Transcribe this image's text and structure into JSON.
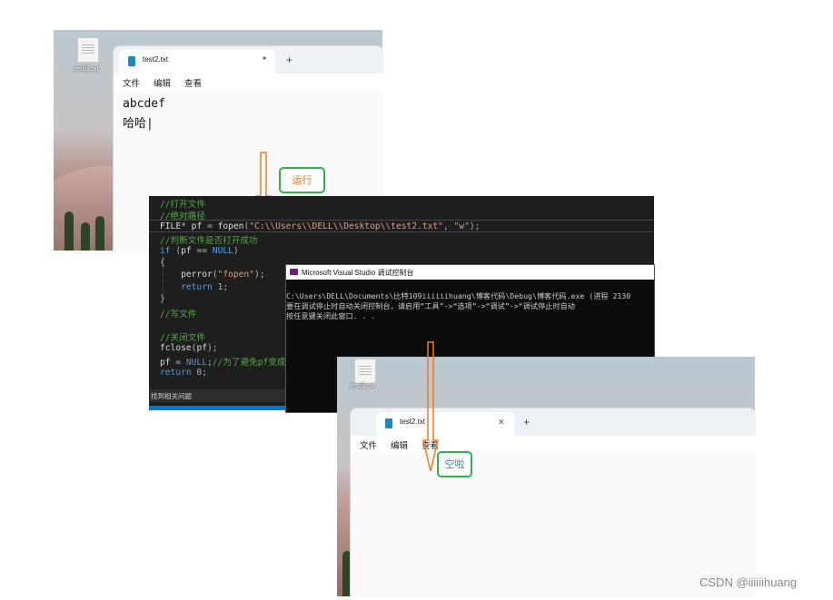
{
  "screen1": {
    "desktop_file_label": "test双.txt",
    "tab_title": "test2.txt",
    "tab_dot": "●",
    "tab_plus": "+",
    "menu": [
      "文件",
      "编辑",
      "查看"
    ],
    "content_lines": [
      "abcdef",
      "哈哈|"
    ]
  },
  "annotation_run": {
    "label": "运行",
    "color": "#e9741f"
  },
  "editor": {
    "lines": [
      [
        {
          "t": "//打开文件",
          "c": "com"
        }
      ],
      [
        {
          "t": "//绝对路径",
          "c": "com"
        }
      ],
      [
        {
          "t": "FILE",
          "c": "id"
        },
        {
          "t": "* ",
          "c": "pu"
        },
        {
          "t": "pf",
          "c": "id"
        },
        {
          "t": " = ",
          "c": "pu"
        },
        {
          "t": "fopen",
          "c": "id"
        },
        {
          "t": "(",
          "c": "pu"
        },
        {
          "t": "\"C:\\\\Users\\\\DELL\\\\Desktop\\\\test2.txt\"",
          "c": "str"
        },
        {
          "t": ", ",
          "c": "pu"
        },
        {
          "t": "\"w\"",
          "c": "str"
        },
        {
          "t": ");",
          "c": "pu"
        }
      ],
      [
        {
          "t": "//判断文件是否打开成功",
          "c": "com"
        }
      ],
      [
        {
          "t": "if",
          "c": "kw"
        },
        {
          "t": " (",
          "c": "pu"
        },
        {
          "t": "pf",
          "c": "id"
        },
        {
          "t": " == ",
          "c": "pu"
        },
        {
          "t": "NULL",
          "c": "kw"
        },
        {
          "t": ")",
          "c": "pu"
        }
      ],
      [
        {
          "t": "{",
          "c": "pu"
        }
      ],
      [
        {
          "t": "    ",
          "c": "pu"
        },
        {
          "t": "perror",
          "c": "id"
        },
        {
          "t": "(",
          "c": "pu"
        },
        {
          "t": "\"fopen\"",
          "c": "str"
        },
        {
          "t": ");",
          "c": "pu"
        }
      ],
      [
        {
          "t": "    ",
          "c": "pu"
        },
        {
          "t": "return",
          "c": "kw"
        },
        {
          "t": " 1;",
          "c": "pu"
        }
      ],
      [
        {
          "t": "}",
          "c": "pu"
        }
      ],
      [
        {
          "t": "//写文件",
          "c": "com"
        }
      ],
      [
        {
          "t": "",
          "c": "pu"
        }
      ],
      [
        {
          "t": "//关闭文件",
          "c": "com"
        }
      ],
      [
        {
          "t": "fclose",
          "c": "id"
        },
        {
          "t": "(",
          "c": "pu"
        },
        {
          "t": "pf",
          "c": "id"
        },
        {
          "t": ");",
          "c": "pu"
        }
      ],
      [
        {
          "t": "pf",
          "c": "id"
        },
        {
          "t": " = ",
          "c": "pu"
        },
        {
          "t": "NULL",
          "c": "kw"
        },
        {
          "t": ";",
          "c": "pu"
        },
        {
          "t": "//为了避免pf变成野",
          "c": "com"
        }
      ],
      [
        {
          "t": "return",
          "c": "kw"
        },
        {
          "t": " 0;",
          "c": "pu"
        }
      ]
    ],
    "error_list_text": "找到相关问题",
    "colors": {
      "com": "#57a64a",
      "kw": "#569cd6",
      "id": "#dcdcdc",
      "str": "#d69d85",
      "pu": "#b4b4b4"
    }
  },
  "console": {
    "title": "Microsoft Visual Studio 调试控制台",
    "lines": [
      "C:\\Users\\DELL\\Documents\\比特109iiiiiihuang\\博客代码\\Debug\\博客代码.exe (进程 2130",
      "要在调试停止时自动关闭控制台，请启用“工具”->“选项”->“调试”->“调试停止时自动",
      "按任意键关闭此窗口. . ."
    ]
  },
  "screen2": {
    "desktop_file_label": "test双.txt",
    "tab_title": "test2.txt",
    "tab_close": "✕",
    "tab_plus": "+",
    "menu": [
      "文件",
      "编辑",
      "查看"
    ]
  },
  "annotation_empty": {
    "label": "空啦",
    "color": "#1e8bc3"
  },
  "watermark": "CSDN @iiiiiihuang"
}
